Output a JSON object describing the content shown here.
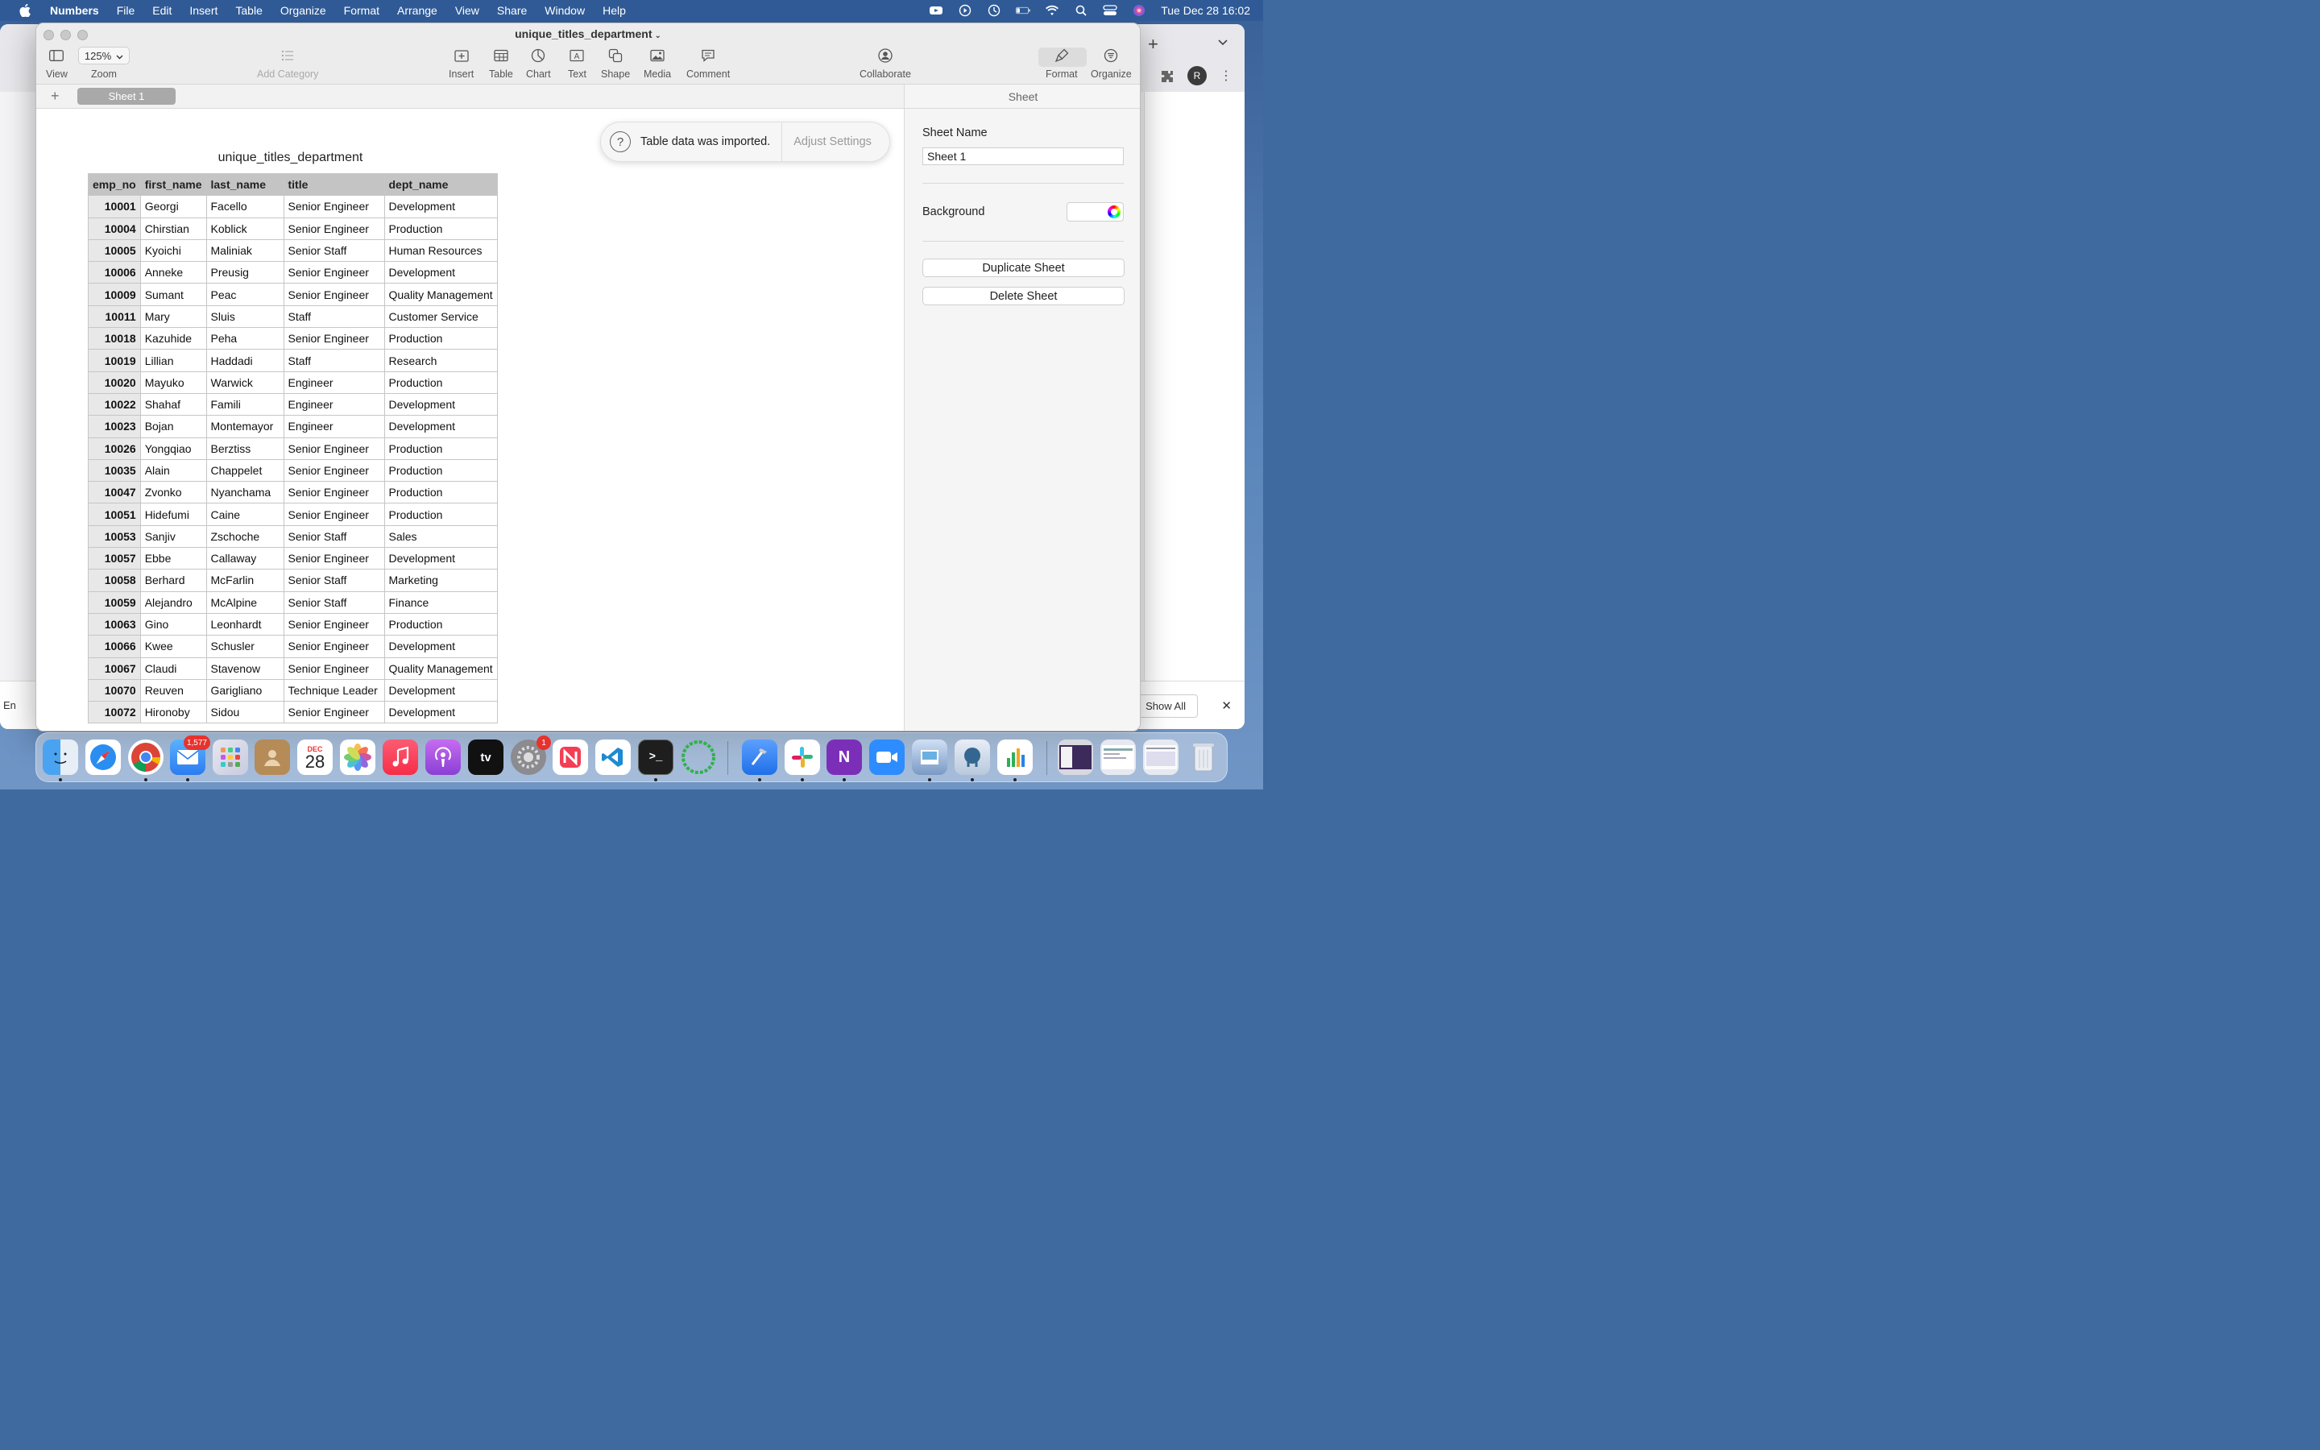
{
  "menubar": {
    "app": "Numbers",
    "items": [
      "File",
      "Edit",
      "Insert",
      "Table",
      "Organize",
      "Format",
      "Arrange",
      "View",
      "Share",
      "Window",
      "Help"
    ],
    "clock": "Tue Dec 28  16:02"
  },
  "window": {
    "title": "unique_titles_department",
    "zoom": "125%",
    "toolbar": {
      "view": "View",
      "zoom": "Zoom",
      "add_category": "Add Category",
      "insert": "Insert",
      "table": "Table",
      "chart": "Chart",
      "text": "Text",
      "shape": "Shape",
      "media": "Media",
      "comment": "Comment",
      "collaborate": "Collaborate",
      "format": "Format",
      "organize": "Organize"
    },
    "sheet_tab": "Sheet 1"
  },
  "toast": {
    "message": "Table data was imported.",
    "action": "Adjust Settings"
  },
  "table": {
    "title": "unique_titles_department",
    "columns": [
      "emp_no",
      "first_name",
      "last_name",
      "title",
      "dept_name"
    ],
    "rows": [
      [
        "10001",
        "Georgi",
        "Facello",
        "Senior Engineer",
        "Development"
      ],
      [
        "10004",
        "Chirstian",
        "Koblick",
        "Senior Engineer",
        "Production"
      ],
      [
        "10005",
        "Kyoichi",
        "Maliniak",
        "Senior Staff",
        "Human Resources"
      ],
      [
        "10006",
        "Anneke",
        "Preusig",
        "Senior Engineer",
        "Development"
      ],
      [
        "10009",
        "Sumant",
        "Peac",
        "Senior Engineer",
        "Quality Management"
      ],
      [
        "10011",
        "Mary",
        "Sluis",
        "Staff",
        "Customer Service"
      ],
      [
        "10018",
        "Kazuhide",
        "Peha",
        "Senior Engineer",
        "Production"
      ],
      [
        "10019",
        "Lillian",
        "Haddadi",
        "Staff",
        "Research"
      ],
      [
        "10020",
        "Mayuko",
        "Warwick",
        "Engineer",
        "Production"
      ],
      [
        "10022",
        "Shahaf",
        "Famili",
        "Engineer",
        "Development"
      ],
      [
        "10023",
        "Bojan",
        "Montemayor",
        "Engineer",
        "Development"
      ],
      [
        "10026",
        "Yongqiao",
        "Berztiss",
        "Senior Engineer",
        "Production"
      ],
      [
        "10035",
        "Alain",
        "Chappelet",
        "Senior Engineer",
        "Production"
      ],
      [
        "10047",
        "Zvonko",
        "Nyanchama",
        "Senior Engineer",
        "Production"
      ],
      [
        "10051",
        "Hidefumi",
        "Caine",
        "Senior Engineer",
        "Production"
      ],
      [
        "10053",
        "Sanjiv",
        "Zschoche",
        "Senior Staff",
        "Sales"
      ],
      [
        "10057",
        "Ebbe",
        "Callaway",
        "Senior Engineer",
        "Development"
      ],
      [
        "10058",
        "Berhard",
        "McFarlin",
        "Senior Staff",
        "Marketing"
      ],
      [
        "10059",
        "Alejandro",
        "McAlpine",
        "Senior Staff",
        "Finance"
      ],
      [
        "10063",
        "Gino",
        "Leonhardt",
        "Senior Engineer",
        "Production"
      ],
      [
        "10066",
        "Kwee",
        "Schusler",
        "Senior Engineer",
        "Development"
      ],
      [
        "10067",
        "Claudi",
        "Stavenow",
        "Senior Engineer",
        "Quality Management"
      ],
      [
        "10070",
        "Reuven",
        "Garigliano",
        "Technique Leader",
        "Development"
      ],
      [
        "10072",
        "Hironoby",
        "Sidou",
        "Senior Engineer",
        "Development"
      ]
    ]
  },
  "sidebar": {
    "tab": "Sheet",
    "sheet_name_label": "Sheet Name",
    "sheet_name_value": "Sheet 1",
    "background_label": "Background",
    "duplicate": "Duplicate Sheet",
    "delete": "Delete Sheet"
  },
  "browser": {
    "avatar": "R",
    "show_all": "Show All",
    "download_text": "En"
  },
  "dock": {
    "mail_badge": "1,577",
    "settings_badge": "1",
    "calendar_month": "DEC",
    "calendar_day": "28"
  }
}
